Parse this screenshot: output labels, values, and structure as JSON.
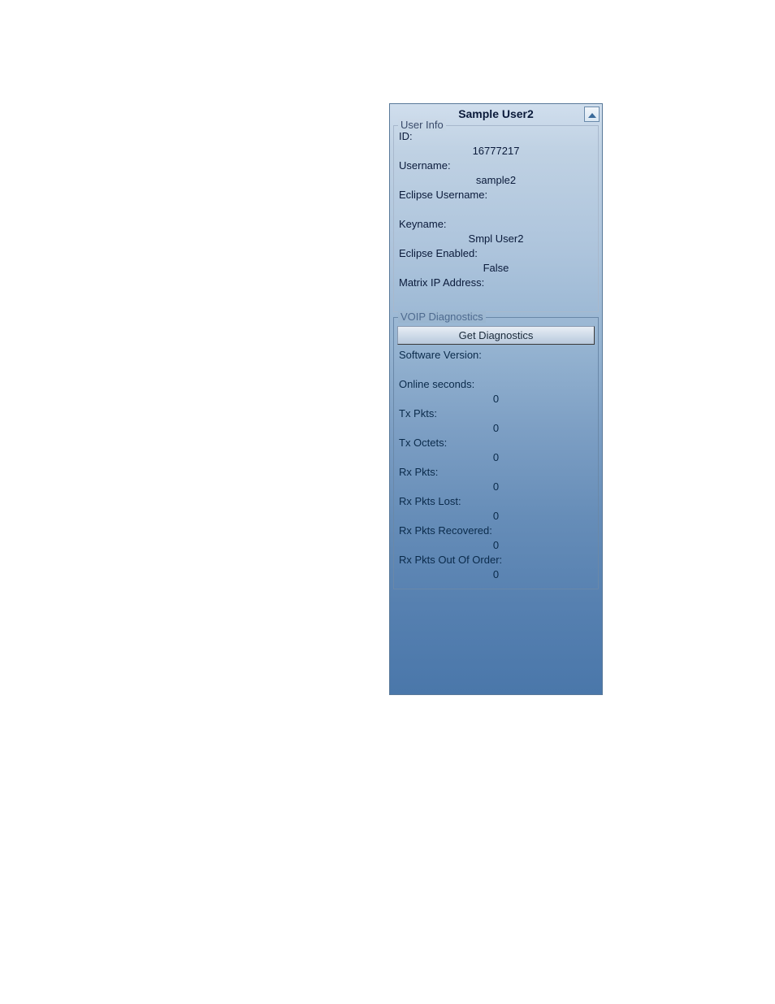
{
  "panel": {
    "title": "Sample User2"
  },
  "userInfo": {
    "legend": "User Info",
    "id_label": "ID:",
    "id_value": "16777217",
    "username_label": "Username:",
    "username_value": "sample2",
    "eclipse_username_label": "Eclipse Username:",
    "eclipse_username_value": "",
    "keyname_label": "Keyname:",
    "keyname_value": "Smpl User2",
    "eclipse_enabled_label": "Eclipse Enabled:",
    "eclipse_enabled_value": "False",
    "matrix_ip_label": "Matrix IP Address:",
    "matrix_ip_value": ""
  },
  "voip": {
    "legend": "VOIP Diagnostics",
    "get_diag_button": "Get Diagnostics",
    "software_version_label": "Software Version:",
    "software_version_value": "",
    "online_seconds_label": "Online seconds:",
    "online_seconds_value": "0",
    "tx_pkts_label": "Tx Pkts:",
    "tx_pkts_value": "0",
    "tx_octets_label": "Tx Octets:",
    "tx_octets_value": "0",
    "rx_pkts_label": "Rx Pkts:",
    "rx_pkts_value": "0",
    "rx_pkts_lost_label": "Rx Pkts Lost:",
    "rx_pkts_lost_value": "0",
    "rx_pkts_recovered_label": "Rx Pkts Recovered:",
    "rx_pkts_recovered_value": "0",
    "rx_pkts_out_of_order_label": "Rx Pkts Out Of Order:",
    "rx_pkts_out_of_order_value": "0"
  }
}
